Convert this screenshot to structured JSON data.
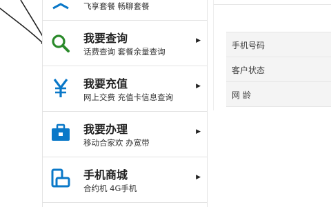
{
  "menu": {
    "items": [
      {
        "title": "",
        "sub": "飞享套餐 畅聊套餐",
        "icon": "package-icon"
      },
      {
        "title": "我要查询",
        "sub": "话费查询 套餐余量查询",
        "icon": "search-icon"
      },
      {
        "title": "我要充值",
        "sub": "网上交费 充值卡信息查询",
        "icon": "yen-icon"
      },
      {
        "title": "我要办理",
        "sub": "移动合家欢 办宽带",
        "icon": "toolbox-icon"
      },
      {
        "title": "手机商城",
        "sub": "合约机 4G手机",
        "icon": "phone-icon"
      }
    ],
    "arrow": "▶"
  },
  "info": {
    "rows": [
      {
        "label": "手机号码"
      },
      {
        "label": "客户状态"
      },
      {
        "label": "网 龄"
      }
    ]
  },
  "colors": {
    "brand": "#0a78c8",
    "highlight": "#fff200",
    "search_icon": "#2a8a2a"
  }
}
